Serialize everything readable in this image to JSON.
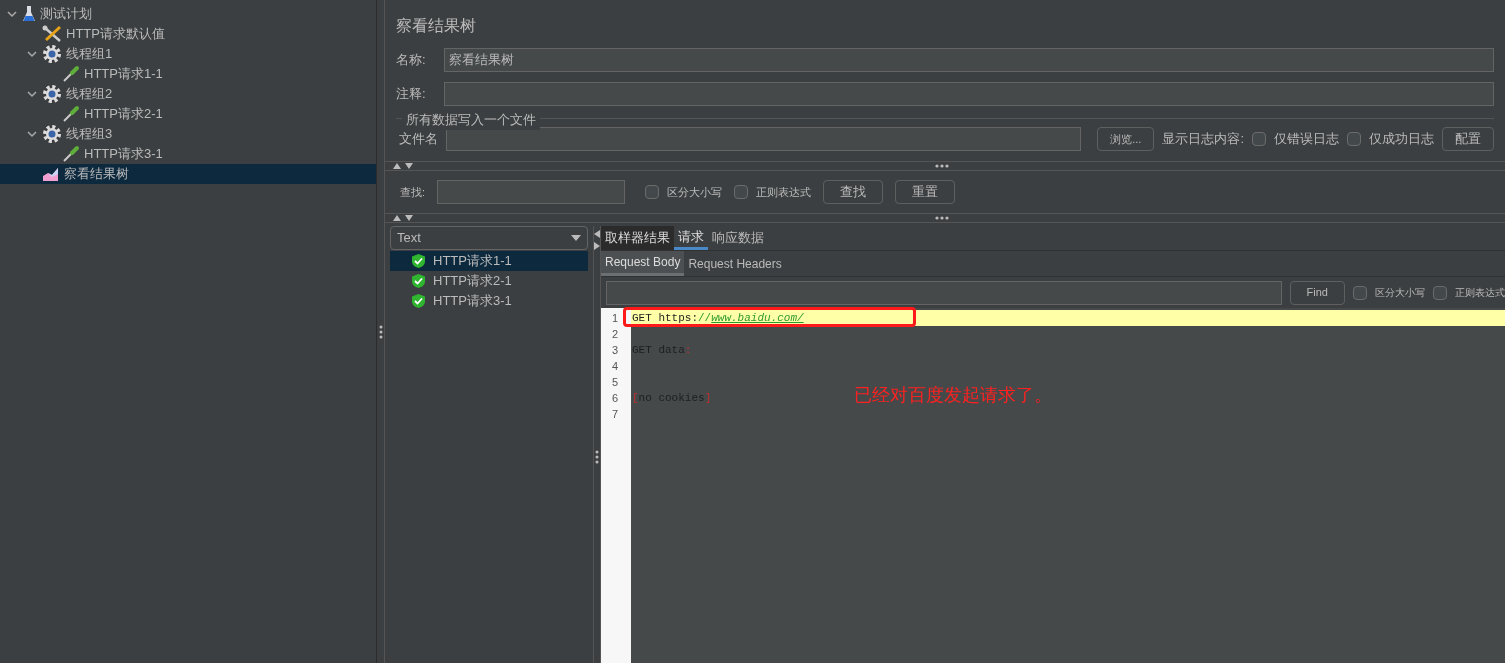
{
  "tree": [
    {
      "label": "测试计划",
      "kind": "plan",
      "expanded": true,
      "selected": false,
      "children": [
        {
          "label": "HTTP请求默认值",
          "kind": "config",
          "selected": false
        },
        {
          "label": "线程组1",
          "kind": "thread_group",
          "expanded": true,
          "selected": false,
          "children": [
            {
              "label": "HTTP请求1-1",
              "kind": "sampler",
              "selected": false
            }
          ]
        },
        {
          "label": "线程组2",
          "kind": "thread_group",
          "expanded": true,
          "selected": false,
          "children": [
            {
              "label": "HTTP请求2-1",
              "kind": "sampler",
              "selected": false
            }
          ]
        },
        {
          "label": "线程组3",
          "kind": "thread_group",
          "expanded": true,
          "selected": false,
          "children": [
            {
              "label": "HTTP请求3-1",
              "kind": "sampler",
              "selected": false
            }
          ]
        },
        {
          "label": "察看结果树",
          "kind": "listener",
          "selected": true
        }
      ]
    }
  ],
  "panel": {
    "title": "察看结果树",
    "name": {
      "label": "名称:",
      "value": "察看结果树"
    },
    "comment": {
      "label": "注释:"
    },
    "file_section": {
      "title": "所有数据写入一个文件",
      "file_label": "文件名",
      "browse": "浏览...",
      "log_label": "显示日志内容:",
      "checks": [
        {
          "label": "仅错误日志",
          "checked": false
        },
        {
          "label": "仅成功日志",
          "checked": false
        }
      ],
      "config_button": "配置"
    },
    "search": {
      "label": "查找:",
      "checks": [
        {
          "label": "区分大小写",
          "checked": false
        },
        {
          "label": "正则表达式",
          "checked": false
        }
      ],
      "buttons": [
        "查找",
        "重置"
      ]
    },
    "renderer": "Text",
    "results": [
      {
        "label": "HTTP请求1-1",
        "selected": true
      },
      {
        "label": "HTTP请求2-1",
        "selected": false
      },
      {
        "label": "HTTP请求3-1",
        "selected": false
      }
    ],
    "tabs": [
      {
        "label": "取样器结果",
        "selected": false
      },
      {
        "label": "请求",
        "selected": true
      },
      {
        "label": "响应数据",
        "selected": false
      }
    ],
    "subtabs": [
      {
        "label": "Request Body",
        "selected": true
      },
      {
        "label": "Request Headers",
        "selected": false
      }
    ],
    "find": {
      "button": "Find",
      "checks": [
        {
          "label": "区分大小写",
          "checked": false
        },
        {
          "label": "正则表达式",
          "checked": false
        }
      ]
    },
    "editor": [
      {
        "number": "1",
        "highlighted": true,
        "parts": [
          {
            "kind": "plain",
            "text": "GET https:"
          },
          {
            "kind": "green",
            "text": "//"
          },
          {
            "kind": "link",
            "text": "www.baidu.com/"
          }
        ]
      },
      {
        "number": "2",
        "highlighted": false
      },
      {
        "number": "3",
        "highlighted": false,
        "parts": [
          {
            "kind": "plain",
            "text": "GET data"
          },
          {
            "kind": "red",
            "text": ":"
          }
        ]
      },
      {
        "number": "4",
        "highlighted": false
      },
      {
        "number": "5",
        "highlighted": false
      },
      {
        "number": "6",
        "highlighted": false,
        "parts": [
          {
            "kind": "red",
            "text": "["
          },
          {
            "kind": "plain",
            "text": "no cookies"
          },
          {
            "kind": "red",
            "text": "]"
          }
        ]
      },
      {
        "number": "7",
        "highlighted": false
      }
    ],
    "annotation": "已经对百度发起请求了。"
  }
}
